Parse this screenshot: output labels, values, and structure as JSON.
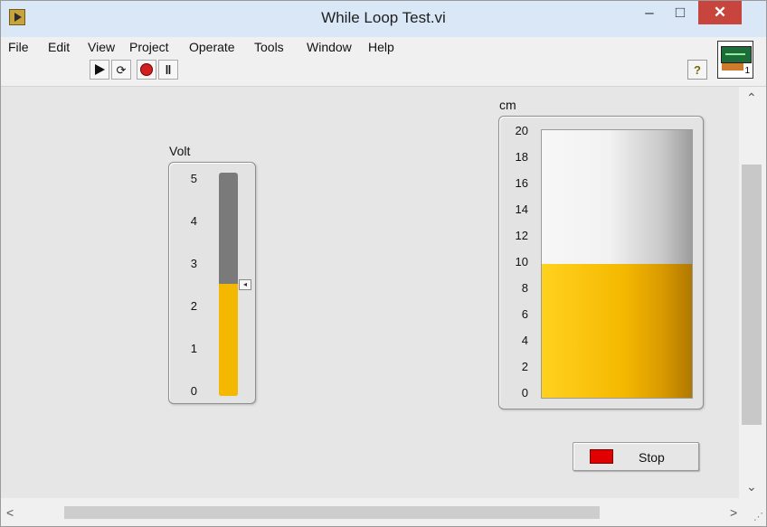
{
  "window": {
    "title": "While Loop Test.vi",
    "minimize": "–",
    "maximize": "□",
    "close": "✕"
  },
  "menu": [
    "File",
    "Edit",
    "View",
    "Project",
    "Operate",
    "Tools",
    "Window",
    "Help"
  ],
  "toolbar": {
    "help_icon": "?",
    "vi_icon_number": "1",
    "buttons": [
      "run-icon",
      "run-continuously-icon",
      "abort-icon",
      "pause-icon"
    ]
  },
  "volt_indicator": {
    "label": "Volt",
    "ticks": [
      "5",
      "4",
      "3",
      "2",
      "1",
      "0"
    ],
    "min": 0,
    "max": 5,
    "value": 2.5,
    "fill_color": "#f5b800",
    "empty_color": "#7a7a7a"
  },
  "cm_indicator": {
    "label": "cm",
    "ticks": [
      "20",
      "18",
      "16",
      "14",
      "12",
      "10",
      "8",
      "6",
      "4",
      "2",
      "0"
    ],
    "min": 0,
    "max": 20,
    "value": 10,
    "fill_color": "#f2b600"
  },
  "stop_button": {
    "label": "Stop",
    "led_color": "#e00000"
  },
  "scrollbars": {
    "up": "⌃",
    "down": "⌄",
    "left": "<",
    "right": ">"
  }
}
